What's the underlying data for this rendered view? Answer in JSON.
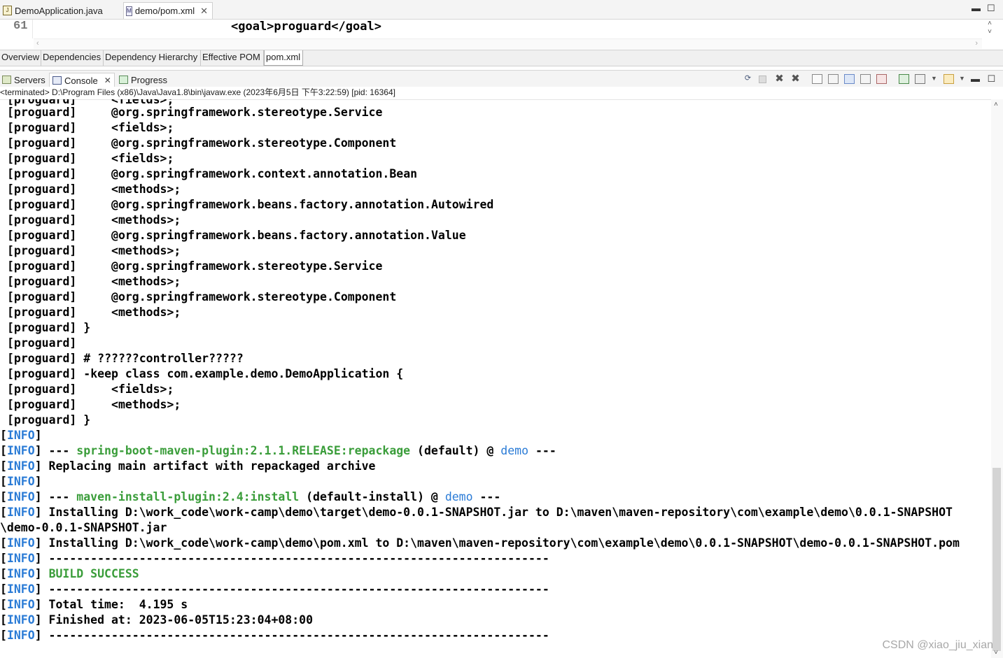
{
  "editor_tabs": [
    {
      "label": "DemoApplication.java",
      "icon": "java-file-icon"
    },
    {
      "label": "demo/pom.xml",
      "icon": "maven-file-icon",
      "close": "✕"
    }
  ],
  "window_controls": {
    "minimize": "▬",
    "maximize": "☐"
  },
  "editor": {
    "line_number": "61",
    "code": "<goal>proguard</goal>"
  },
  "pom_tabs": [
    "Overview",
    "Dependencies",
    "Dependency Hierarchy",
    "Effective POM",
    "pom.xml"
  ],
  "view_tabs": [
    {
      "label": "Servers",
      "icon": "servers-icon"
    },
    {
      "label": "Console",
      "icon": "console-icon",
      "close": "✕"
    },
    {
      "label": "Progress",
      "icon": "progress-icon"
    }
  ],
  "status_line": "<terminated> D:\\Program Files (x86)\\Java\\Java1.8\\bin\\javaw.exe (2023年6月5日 下午3:22:59) [pid: 16364]",
  "console": {
    "lines": [
      [
        "[proguard]     @org.springframework.stereotype.Service"
      ],
      [
        "[proguard]     <fields>;"
      ],
      [
        "[proguard]     @org.springframework.stereotype.Component"
      ],
      [
        "[proguard]     <fields>;"
      ],
      [
        "[proguard]     @org.springframework.context.annotation.Bean"
      ],
      [
        "[proguard]     <methods>;"
      ],
      [
        "[proguard]     @org.springframework.beans.factory.annotation.Autowired"
      ],
      [
        "[proguard]     <methods>;"
      ],
      [
        "[proguard]     @org.springframework.beans.factory.annotation.Value"
      ],
      [
        "[proguard]     <methods>;"
      ],
      [
        "[proguard]     @org.springframework.stereotype.Service"
      ],
      [
        "[proguard]     <methods>;"
      ],
      [
        "[proguard]     @org.springframework.stereotype.Component"
      ],
      [
        "[proguard]     <methods>;"
      ],
      [
        "[proguard] }"
      ],
      [
        "[proguard]"
      ],
      [
        "[proguard] # ??????controller?????"
      ],
      [
        "[proguard] -keep class com.example.demo.DemoApplication {"
      ],
      [
        "[proguard]     <fields>;"
      ],
      [
        "[proguard]     <methods>;"
      ],
      [
        "[proguard] }"
      ]
    ],
    "info_lines": [
      {
        "info": "INFO",
        "parts": [
          {
            "t": "",
            "c": ""
          }
        ]
      },
      {
        "info": "INFO",
        "parts": [
          {
            "t": " --- ",
            "c": ""
          },
          {
            "t": "spring-boot-maven-plugin:2.1.1.RELEASE:repackage",
            "c": "green"
          },
          {
            "t": " (default) @ ",
            "c": ""
          },
          {
            "t": "demo",
            "c": "blue"
          },
          {
            "t": " ---",
            "c": ""
          }
        ]
      },
      {
        "info": "INFO",
        "parts": [
          {
            "t": " Replacing main artifact with repackaged archive",
            "c": ""
          }
        ]
      },
      {
        "info": "INFO",
        "parts": [
          {
            "t": "",
            "c": ""
          }
        ]
      },
      {
        "info": "INFO",
        "parts": [
          {
            "t": " --- ",
            "c": ""
          },
          {
            "t": "maven-install-plugin:2.4:install",
            "c": "green"
          },
          {
            "t": " (default-install) @ ",
            "c": ""
          },
          {
            "t": "demo",
            "c": "blue"
          },
          {
            "t": " ---",
            "c": ""
          }
        ]
      },
      {
        "info": "INFO",
        "parts": [
          {
            "t": " Installing D:\\work_code\\work-camp\\demo\\target\\demo-0.0.1-SNAPSHOT.jar to D:\\maven\\maven-repository\\com\\example\\demo\\0.0.1-SNAPSHOT",
            "c": ""
          }
        ]
      },
      {
        "info": "",
        "parts": [
          {
            "t": "\\demo-0.0.1-SNAPSHOT.jar",
            "c": ""
          }
        ]
      },
      {
        "info": "INFO",
        "parts": [
          {
            "t": " Installing D:\\work_code\\work-camp\\demo\\pom.xml to D:\\maven\\maven-repository\\com\\example\\demo\\0.0.1-SNAPSHOT\\demo-0.0.1-SNAPSHOT.pom",
            "c": ""
          }
        ]
      },
      {
        "info": "INFO",
        "parts": [
          {
            "t": " ------------------------------------------------------------------------",
            "c": ""
          }
        ]
      },
      {
        "info": "INFO",
        "parts": [
          {
            "t": " ",
            "c": ""
          },
          {
            "t": "BUILD SUCCESS",
            "c": "green"
          }
        ]
      },
      {
        "info": "INFO",
        "parts": [
          {
            "t": " ------------------------------------------------------------------------",
            "c": ""
          }
        ]
      },
      {
        "info": "INFO",
        "parts": [
          {
            "t": " Total time:  4.195 s",
            "c": ""
          }
        ]
      },
      {
        "info": "INFO",
        "parts": [
          {
            "t": " Finished at: 2023-06-05T15:23:04+08:00",
            "c": ""
          }
        ]
      },
      {
        "info": "INFO",
        "parts": [
          {
            "t": " ------------------------------------------------------------------------",
            "c": ""
          }
        ]
      }
    ]
  },
  "toolbar_icons": [
    "pin-icon",
    "terminate-icon",
    "remove-launch-icon",
    "remove-all-icon",
    "clear-console-icon",
    "scroll-lock-icon",
    "word-wrap-icon",
    "show-on-output-icon",
    "show-on-error-icon",
    "pin-console-icon",
    "display-console-icon",
    "open-console-icon",
    "view-menu-icon",
    "minimize-icon",
    "maximize-icon"
  ],
  "watermark": "CSDN @xiao_jiu_xian"
}
